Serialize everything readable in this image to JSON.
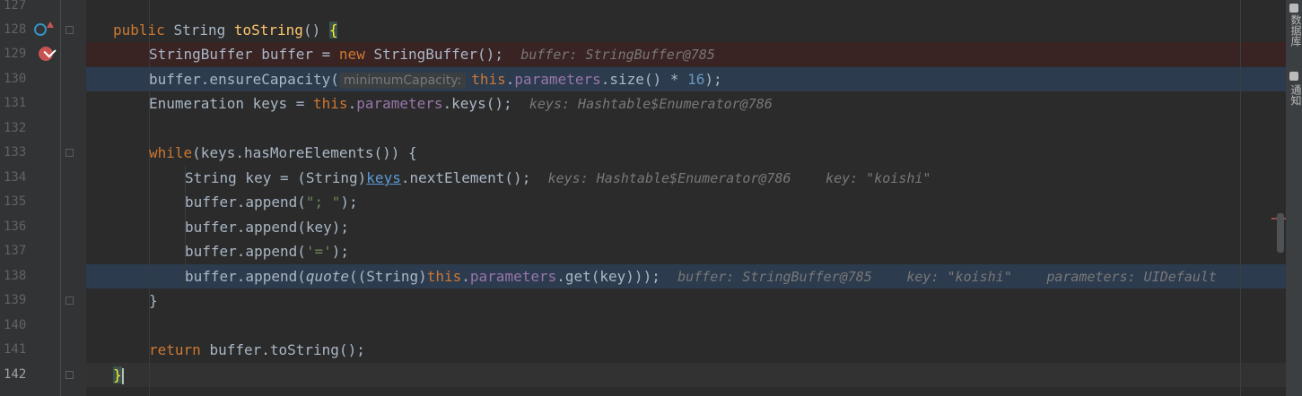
{
  "gutter": {
    "line_numbers": [
      "127",
      "128",
      "129",
      "130",
      "131",
      "132",
      "133",
      "134",
      "135",
      "136",
      "137",
      "138",
      "139",
      "140",
      "141",
      "142"
    ]
  },
  "code": {
    "l128": {
      "kw": "public ",
      "type": "String ",
      "name": "toString",
      "rest": "() ",
      "brace": "{"
    },
    "l129": {
      "a": "StringBuffer buffer = ",
      "kw": "new ",
      "b": "StringBuffer();",
      "dbg": "buffer: StringBuffer@785"
    },
    "l130": {
      "a": "buffer.ensureCapacity(",
      "hint": "minimumCapacity:",
      "kw": "this",
      "dot": ".",
      "fld": "parameters",
      "b": ".size() * ",
      "num": "16",
      "c": ");"
    },
    "l131": {
      "a": "Enumeration keys = ",
      "kw": "this",
      "dot": ".",
      "fld": "parameters",
      "b": ".keys();",
      "dbg": "keys: Hashtable$Enumerator@786"
    },
    "l133": {
      "kw": "while",
      "a": "(keys.hasMoreElements()) {"
    },
    "l134": {
      "a": "String key = (String)",
      "und": "keys",
      "b": ".nextElement();",
      "dbg1": "keys: Hashtable$Enumerator@786",
      "dbg2": "key: \"koishi\""
    },
    "l135": {
      "a": "buffer.append(",
      "str": "\"; \"",
      "b": ");"
    },
    "l136": {
      "a": "buffer.append(key);"
    },
    "l137": {
      "a": "buffer.append(",
      "str": "'='",
      "b": ");"
    },
    "l138": {
      "a": "buffer.append(",
      "it": "quote",
      "b": "((String)",
      "kw": "this",
      "dot": ".",
      "fld": "parameters",
      "c": ".get(key)));",
      "dbg1": "buffer: StringBuffer@785",
      "dbg2": "key: \"koishi\"",
      "dbg3": "parameters: UIDefault"
    },
    "l139": {
      "a": "}"
    },
    "l141": {
      "kw": "return ",
      "a": "buffer.toString();"
    },
    "l142": {
      "brace": "}"
    }
  },
  "tool_window": {
    "database_label": "数据库",
    "notifications_label": "通知"
  },
  "colors": {
    "background": "#2b2b2b",
    "gutter": "#313335",
    "breakpoint": "#c75450",
    "execution_line": "#2d3b4e",
    "keyword": "#cc7832",
    "method": "#ffc66d",
    "field": "#9876aa",
    "string": "#6a8759",
    "number": "#6897bb"
  }
}
